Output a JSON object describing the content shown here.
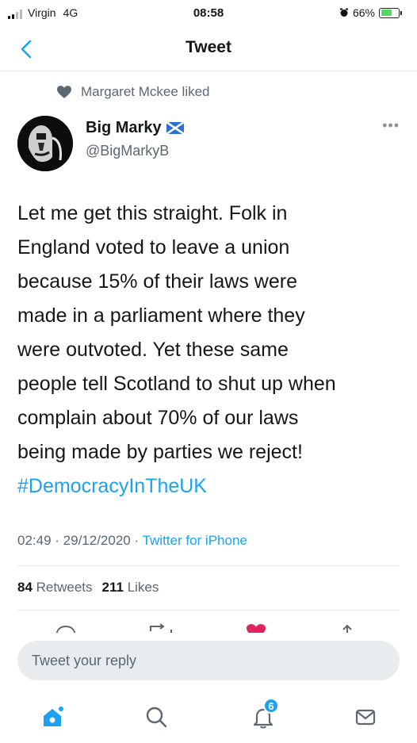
{
  "status_bar": {
    "carrier": "Virgin",
    "network": "4G",
    "time": "08:58",
    "battery": "66%",
    "battery_level": 0.66
  },
  "nav": {
    "title": "Tweet",
    "back_icon": "chevron-left-icon"
  },
  "social_context": {
    "text": "Margaret Mckee liked",
    "icon": "heart-icon"
  },
  "tweet": {
    "author_name": "Big Marky",
    "author_handle": "@BigMarkyB",
    "lines": [
      "Let me get this straight. Folk in",
      "England voted to leave a union",
      "because 15% of their laws were",
      "made in a parliament where they",
      "were outvoted. Yet these same",
      "people tell Scotland to shut up when",
      "complain about 70% of our laws",
      "being made by parties we reject!"
    ],
    "hashtag": "#DemocracyInTheUK",
    "time": "02:49",
    "date": "29/12/2020",
    "source": "Twitter for iPhone",
    "retweet_count": "84",
    "retweets_label": "Retweets",
    "like_count": "211",
    "likes_label": "Likes"
  },
  "reply": {
    "placeholder": "Tweet your reply"
  },
  "tabbar": {
    "items": [
      "home-icon",
      "search-icon",
      "notifications-icon",
      "messages-icon"
    ],
    "notification_badge": "6"
  },
  "colors": {
    "accent": "#1da1f2",
    "like": "#e0245e",
    "text": "#14171a",
    "secondary": "#5b6772"
  }
}
